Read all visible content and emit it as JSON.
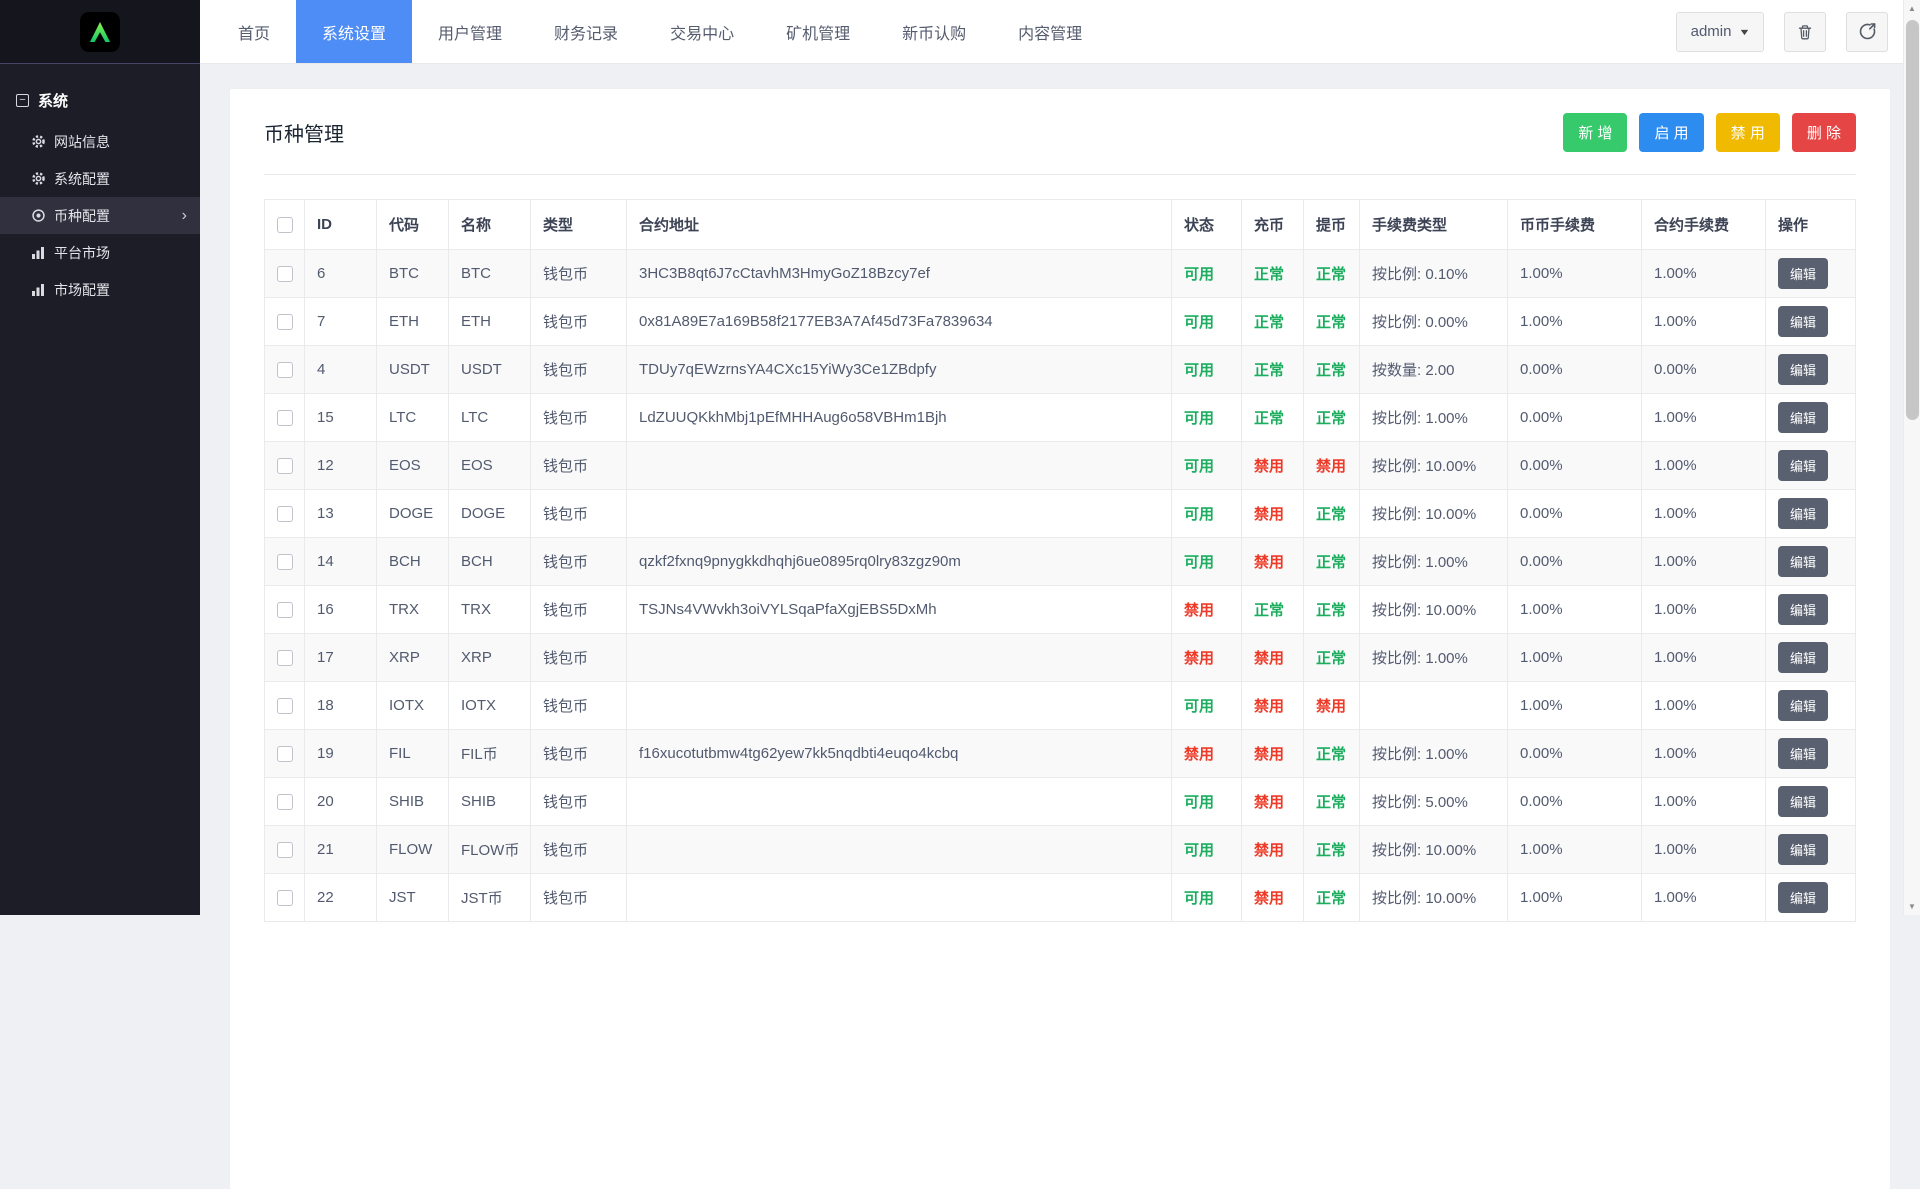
{
  "topbar": {
    "nav": [
      {
        "label": "首页",
        "active": false
      },
      {
        "label": "系统设置",
        "active": true
      },
      {
        "label": "用户管理",
        "active": false
      },
      {
        "label": "财务记录",
        "active": false
      },
      {
        "label": "交易中心",
        "active": false
      },
      {
        "label": "矿机管理",
        "active": false
      },
      {
        "label": "新币认购",
        "active": false
      },
      {
        "label": "内容管理",
        "active": false
      }
    ],
    "active_tab_color": "#4e8df5",
    "user_label": "admin"
  },
  "sidebar": {
    "section_label": "系统",
    "items": [
      {
        "label": "网站信息",
        "icon": "gear-icon",
        "active": false
      },
      {
        "label": "系统配置",
        "icon": "gear-icon",
        "active": false
      },
      {
        "label": "币种配置",
        "icon": "target-icon",
        "active": true
      },
      {
        "label": "平台市场",
        "icon": "bar-chart-icon",
        "active": false
      },
      {
        "label": "市场配置",
        "icon": "bar-chart-icon",
        "active": false
      }
    ],
    "logo_color": "#3fe065"
  },
  "page": {
    "title": "币种管理",
    "actions": [
      {
        "label": "新 增",
        "color": "#36ca6d"
      },
      {
        "label": "启 用",
        "color": "#2d8cf0"
      },
      {
        "label": "禁 用",
        "color": "#f0ba00"
      },
      {
        "label": "删 除",
        "color": "#e64545"
      }
    ]
  },
  "table": {
    "columns": [
      "ID",
      "代码",
      "名称",
      "类型",
      "合约地址",
      "状态",
      "充币",
      "提币",
      "手续费类型",
      "币币手续费",
      "合约手续费",
      "操作"
    ],
    "edit_label": "编辑",
    "status_colors": {
      "enabled": "#1cad5f",
      "disabled": "#ee3b28"
    },
    "rows": [
      {
        "id": "6",
        "code": "BTC",
        "name": "BTC",
        "type": "钱包币",
        "contract": "3HC3B8qt6J7cCtavhM3HmyGoZ18Bzcy7ef",
        "status": "可用",
        "deposit": "正常",
        "withdraw": "正常",
        "fee_type": "按比例: 0.10%",
        "spot_fee": "1.00%",
        "contract_fee": "1.00%"
      },
      {
        "id": "7",
        "code": "ETH",
        "name": "ETH",
        "type": "钱包币",
        "contract": "0x81A89E7a169B58f2177EB3A7Af45d73Fa7839634",
        "status": "可用",
        "deposit": "正常",
        "withdraw": "正常",
        "fee_type": "按比例: 0.00%",
        "spot_fee": "1.00%",
        "contract_fee": "1.00%"
      },
      {
        "id": "4",
        "code": "USDT",
        "name": "USDT",
        "type": "钱包币",
        "contract": "TDUy7qEWzrnsYA4CXc15YiWy3Ce1ZBdpfy",
        "status": "可用",
        "deposit": "正常",
        "withdraw": "正常",
        "fee_type": "按数量: 2.00",
        "spot_fee": "0.00%",
        "contract_fee": "0.00%"
      },
      {
        "id": "15",
        "code": "LTC",
        "name": "LTC",
        "type": "钱包币",
        "contract": "LdZUUQKkhMbj1pEfMHHAug6o58VBHm1Bjh",
        "status": "可用",
        "deposit": "正常",
        "withdraw": "正常",
        "fee_type": "按比例: 1.00%",
        "spot_fee": "0.00%",
        "contract_fee": "1.00%"
      },
      {
        "id": "12",
        "code": "EOS",
        "name": "EOS",
        "type": "钱包币",
        "contract": "",
        "status": "可用",
        "deposit": "禁用",
        "withdraw": "禁用",
        "fee_type": "按比例: 10.00%",
        "spot_fee": "0.00%",
        "contract_fee": "1.00%"
      },
      {
        "id": "13",
        "code": "DOGE",
        "name": "DOGE",
        "type": "钱包币",
        "contract": "",
        "status": "可用",
        "deposit": "禁用",
        "withdraw": "正常",
        "fee_type": "按比例: 10.00%",
        "spot_fee": "0.00%",
        "contract_fee": "1.00%"
      },
      {
        "id": "14",
        "code": "BCH",
        "name": "BCH",
        "type": "钱包币",
        "contract": "qzkf2fxnq9pnygkkdhqhj6ue0895rq0lry83zgz90m",
        "status": "可用",
        "deposit": "禁用",
        "withdraw": "正常",
        "fee_type": "按比例: 1.00%",
        "spot_fee": "0.00%",
        "contract_fee": "1.00%"
      },
      {
        "id": "16",
        "code": "TRX",
        "name": "TRX",
        "type": "钱包币",
        "contract": "TSJNs4VWvkh3oiVYLSqaPfaXgjEBS5DxMh",
        "status": "禁用",
        "deposit": "正常",
        "withdraw": "正常",
        "fee_type": "按比例: 10.00%",
        "spot_fee": "1.00%",
        "contract_fee": "1.00%"
      },
      {
        "id": "17",
        "code": "XRP",
        "name": "XRP",
        "type": "钱包币",
        "contract": "",
        "status": "禁用",
        "deposit": "禁用",
        "withdraw": "正常",
        "fee_type": "按比例: 1.00%",
        "spot_fee": "1.00%",
        "contract_fee": "1.00%"
      },
      {
        "id": "18",
        "code": "IOTX",
        "name": "IOTX",
        "type": "钱包币",
        "contract": "",
        "status": "可用",
        "deposit": "禁用",
        "withdraw": "禁用",
        "fee_type": "",
        "spot_fee": "1.00%",
        "contract_fee": "1.00%"
      },
      {
        "id": "19",
        "code": "FIL",
        "name": "FIL币",
        "type": "钱包币",
        "contract": "f16xucotutbmw4tg62yew7kk5nqdbti4euqo4kcbq",
        "status": "禁用",
        "deposit": "禁用",
        "withdraw": "正常",
        "fee_type": "按比例: 1.00%",
        "spot_fee": "0.00%",
        "contract_fee": "1.00%"
      },
      {
        "id": "20",
        "code": "SHIB",
        "name": "SHIB",
        "type": "钱包币",
        "contract": "",
        "status": "可用",
        "deposit": "禁用",
        "withdraw": "正常",
        "fee_type": "按比例: 5.00%",
        "spot_fee": "0.00%",
        "contract_fee": "1.00%"
      },
      {
        "id": "21",
        "code": "FLOW",
        "name": "FLOW币",
        "type": "钱包币",
        "contract": "",
        "status": "可用",
        "deposit": "禁用",
        "withdraw": "正常",
        "fee_type": "按比例: 10.00%",
        "spot_fee": "1.00%",
        "contract_fee": "1.00%"
      },
      {
        "id": "22",
        "code": "JST",
        "name": "JST币",
        "type": "钱包币",
        "contract": "",
        "status": "可用",
        "deposit": "禁用",
        "withdraw": "正常",
        "fee_type": "按比例: 10.00%",
        "spot_fee": "1.00%",
        "contract_fee": "1.00%"
      }
    ]
  }
}
